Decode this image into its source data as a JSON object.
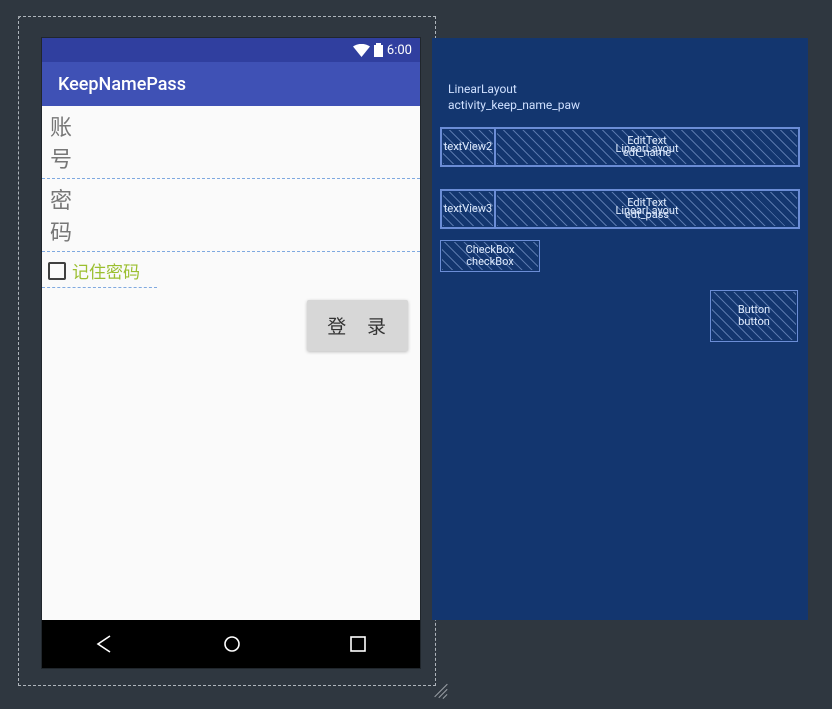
{
  "statusbar": {
    "time": "6:00"
  },
  "appbar": {
    "title": "KeepNamePass"
  },
  "form": {
    "username_label": "账 号",
    "password_label": "密 码",
    "remember_label": "记住密码",
    "login_label": "登 录"
  },
  "blueprint": {
    "root1": "LinearLayout",
    "root2": "activity_keep_name_paw",
    "row1": {
      "tv": "textView2",
      "et1": "EditText",
      "ll": "LinearLayout",
      "et2": "edt_name"
    },
    "row2": {
      "tv": "textView3",
      "et1": "EditText",
      "ll": "LinearLayout",
      "et2": "edt_pass"
    },
    "checkbox": {
      "l1": "CheckBox",
      "l2": "checkBox"
    },
    "button": {
      "l1": "Button",
      "l2": "button"
    }
  }
}
